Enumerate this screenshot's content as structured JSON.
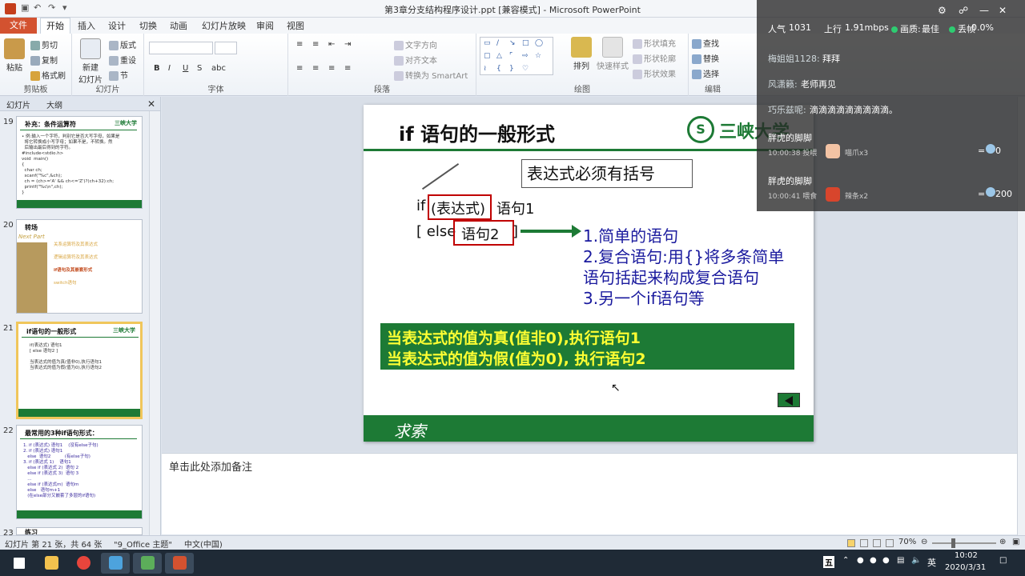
{
  "window": {
    "title": "第3章分支结构程序设计.ppt [兼容模式] - Microsoft PowerPoint"
  },
  "tabs": [
    "文件",
    "开始",
    "插入",
    "设计",
    "切换",
    "动画",
    "幻灯片放映",
    "审阅",
    "视图"
  ],
  "ribbon": {
    "clipboard": {
      "paste": "粘贴",
      "cut": "剪切",
      "copy": "复制",
      "format_painter": "格式刷",
      "label": "剪贴板"
    },
    "slides": {
      "new_slide_1": "新建",
      "new_slide_2": "幻灯片",
      "layout": "版式",
      "reset": "重设",
      "section": "节",
      "label": "幻灯片"
    },
    "font": {
      "label": "字体"
    },
    "paragraph": {
      "text_direction": "文字方向",
      "align_text": "对齐文本",
      "smartart": "转换为 SmartArt",
      "label": "段落"
    },
    "drawing": {
      "arrange": "排列",
      "quick_styles": "快速样式",
      "shape_fill": "形状填充",
      "shape_outline": "形状轮廓",
      "shape_effects": "形状效果",
      "label": "绘图"
    },
    "editing": {
      "find": "查找",
      "replace": "替换",
      "select": "选择",
      "label": "编辑"
    }
  },
  "panel": {
    "tab_slides": "幻灯片",
    "tab_outline": "大纲",
    "thumbs": [
      {
        "num": "19",
        "title": "补充：条件运算符",
        "body": "• 例:输入一个字符，判别它是否大写字母，如果是\n  将它转换成小写字母；如果不是，不转换。然\n  后输出最后得到的字符。\n#include<stdio.h>\nvoid  main()\n{\n  char ch;\n  scanf(\"%c\",&ch);\n  ch = (ch>='A' && ch<='Z')?(ch+32):ch;\n  printf(\"%c\\n\",ch);\n}"
      },
      {
        "num": "20",
        "title": "转场",
        "next": "Next Part",
        "items": [
          "关系运算符及其表达式",
          "逻辑运算符及其表达式",
          "if语句及其嵌套形式",
          "switch语句"
        ]
      },
      {
        "num": "21",
        "title": "if语句的一般形式",
        "body": "if(表达式) 语句1\n[ else 语句2 ]\n\n当表达式的值为真(值非0),执行语句1\n当表达式的值为假(值为0),执行语句2",
        "selected": true
      },
      {
        "num": "22",
        "title": "最常用的3种if语句形式：",
        "body": "1. if (表达式) 语句1    (没有else子句)\n2. if (表达式) 语句1\n   else  语句2          (有else子句)\n3. if (表达式 1)    语句1\n   else if (表达式 2)  语句 2\n   else if (表达式 3)  语句 3\n   ...\n   else if (表达式m)  语句m\n   else   语句m+1\n   (在else部分又嵌套了多层的if语句)"
      },
      {
        "num": "23",
        "title": "练习"
      }
    ]
  },
  "slide": {
    "title": "if 语句的一般形式",
    "logo_mark": "S",
    "logo_text": "三峡大学",
    "callout": "表达式必须有括号",
    "code_if": "if",
    "code_expr": "(表达式)",
    "code_stmt1": "语句1",
    "code_else_open": "[ else",
    "code_stmt2": "语句2",
    "code_close": "]",
    "list": [
      "1.简单的语句",
      "2.复合语句:用{}将多条简单",
      "语句括起来构成复合语句",
      "3.另一个if语句等"
    ],
    "green_lines": [
      "当表达式的值为真(值非0),执行语句1",
      "当表达式的值为假(值为0), 执行语句2"
    ],
    "footer": "求索"
  },
  "notes": {
    "placeholder": "单击此处添加备注"
  },
  "status": {
    "slide_info": "幻灯片 第 21 张，共 64 张",
    "theme": "\"9_Office 主题\"",
    "language": "中文(中国)",
    "zoom": "70%"
  },
  "taskbar": {
    "ime": "英",
    "time": "10:02",
    "date": "2020/3/31",
    "ime2": "五"
  },
  "overlay": {
    "popularity_label": "人气",
    "popularity_value": "1031",
    "upload_label": "上行",
    "upload_value": "1.91mbps",
    "quality_label": "画质:",
    "quality_value": "最佳",
    "drop_label": "丢帧",
    "drop_value": "0.0%",
    "messages": [
      {
        "user": "梅姐姐1128:",
        "text": "拜拜"
      },
      {
        "user": "风潇籁:",
        "text": "老师再见"
      },
      {
        "user": "巧乐兹呢:",
        "text": "滴滴滴滴滴滴滴滴滴。"
      }
    ],
    "gifts": [
      {
        "user": "胖虎的脚脚",
        "time": "10:00:38 投喂",
        "gift": "喵爪x3",
        "value": "0"
      },
      {
        "user": "胖虎的脚脚",
        "time": "10:00:41 喂食",
        "gift": "辣条x2",
        "value": "200"
      }
    ]
  }
}
